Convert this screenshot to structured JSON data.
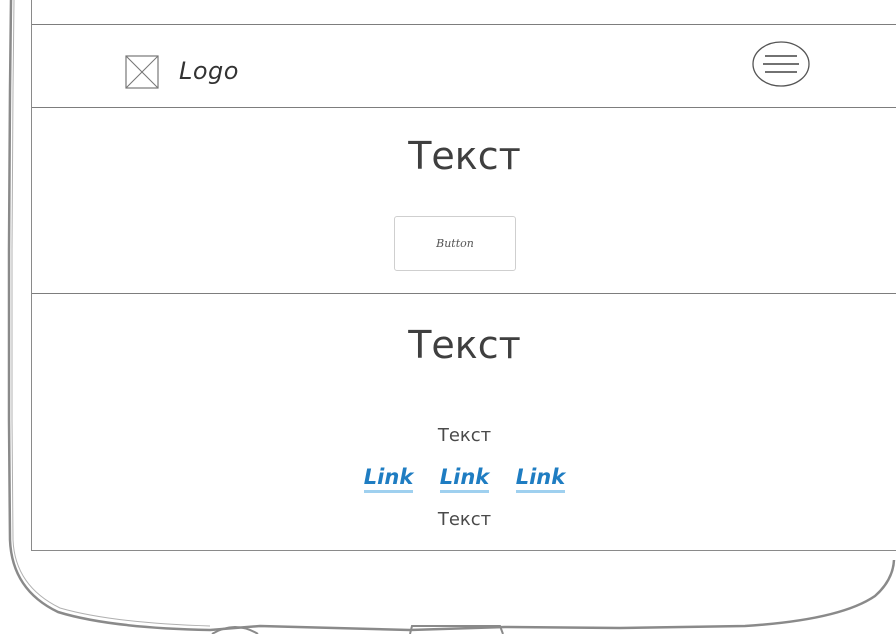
{
  "header": {
    "logo_label": "Logo"
  },
  "hero": {
    "heading": "Текст",
    "button_label": "Button"
  },
  "content": {
    "heading": "Текст",
    "text_top": "Текст",
    "links": [
      "Link",
      "Link",
      "Link"
    ],
    "text_bottom": "Текст"
  },
  "colors": {
    "link": "#1f7dc2",
    "link_underline": "#9fd0ef",
    "text": "#3f3f3f",
    "border": "#7d7d7d"
  },
  "icons": {
    "logo": "image-placeholder-icon",
    "menu": "hamburger-menu-icon"
  }
}
